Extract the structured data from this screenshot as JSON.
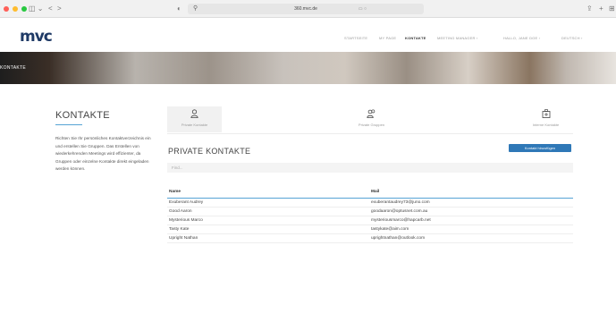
{
  "browser": {
    "url": "360.mvc.de",
    "back": "<",
    "forward": ">",
    "sidebar_icon": "sidebar-icon",
    "share_icon": "share-icon",
    "new_tab_icon": "+"
  },
  "header": {
    "logo": "mvc",
    "nav": [
      "STARTSEITE",
      "MY PAGE",
      "KONTAKTE",
      "MEETING MANAGER ›",
      "HALLO, JANE DOE ›",
      "DEUTSCH ›"
    ],
    "active_index": 2
  },
  "banner": {
    "title": "KONTAKTE"
  },
  "sidebar": {
    "title": "KONTAKTE",
    "text": "Richten Sie Ihr persönliches Kontaktverzeichnis ein und erstellen Sie Gruppen. Das Erstellen von wiederkehrenden Meetings wird effizienter, da Gruppen oder einzelne Kontakte direkt eingeladen werden können."
  },
  "tabs": [
    {
      "label": "Private Kontakte",
      "icon": "user-icon"
    },
    {
      "label": "Private Gruppen",
      "icon": "group-icon"
    },
    {
      "label": "Interne Kontakte",
      "icon": "building-icon"
    }
  ],
  "section": {
    "title": "PRIVATE KONTAKTE",
    "add_button": "Kontakt hinzufügen",
    "search_placeholder": "Find..."
  },
  "table": {
    "headers": [
      "Name",
      "Mail"
    ],
    "rows": [
      [
        "Exuberant Audrey",
        "exuberantaudrey73@juno.com"
      ],
      [
        "Good Aaron",
        "goodaaron@optusnet.com.au"
      ],
      [
        "Mysterious Marco",
        "mysteriousmarco@hapcarb.net"
      ],
      [
        "Tasty Kate",
        "tastykate@aim.com"
      ],
      [
        "Upright Nathan",
        "uprightnathan@outlook.com"
      ]
    ]
  },
  "colors": {
    "accent": "#2f78b7",
    "underline": "#56a3d5",
    "logo": "#1f3a66"
  }
}
